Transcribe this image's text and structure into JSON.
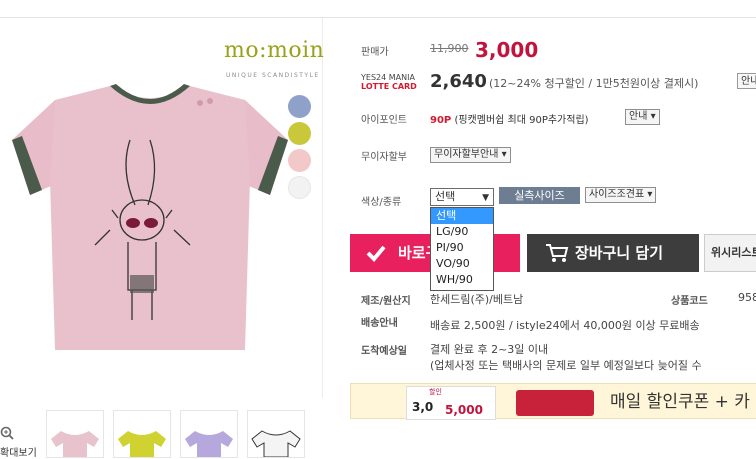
{
  "brand": {
    "logo": "mo:moin",
    "tagline": "UNIQUE SCANDISTYLE"
  },
  "product_image": {
    "print_text": "mo:moin"
  },
  "swatches": [
    "#8fa0c9",
    "#c8c83a",
    "#f2c8c8",
    "#f2f2f2"
  ],
  "thumbnails": {
    "zoom_label": "확대보기",
    "colors": [
      "#e8c2cc",
      "#cfd231",
      "#b6a7dc",
      "#f4f4f4"
    ]
  },
  "price": {
    "label": "판매가",
    "original": "11,900",
    "sale": "3,000"
  },
  "card": {
    "line1": "YES24 MANIA",
    "line2": "LOTTE CARD",
    "price": "2,640",
    "note": "(12~24% 청구할인 / 1만5천원이상 결제시)",
    "info_button": "안내"
  },
  "ipoint": {
    "label": "아이포인트",
    "value": "90P",
    "note": "(핑캣멤버쉽 최대 90P추가적립)",
    "info_button": "안내"
  },
  "installment": {
    "label": "무이자할부",
    "button": "무이자할부안내"
  },
  "option": {
    "label": "색상/종류",
    "selected": "선택",
    "options": [
      "선택",
      "LG/90",
      "PI/90",
      "VO/90",
      "WH/90"
    ],
    "size_button": "실측사이즈",
    "size_table_button": "사이즈조견표"
  },
  "actions": {
    "buy": "바로구매",
    "cart": "장바구니 담기",
    "wish": "위시리스트"
  },
  "details": {
    "maker_label": "제조/원산지",
    "maker_value": "한세드림(주)/베트남",
    "code_label": "상품코드",
    "code_value": "958",
    "shipping_label": "배송안내",
    "shipping_value": "배송료 2,500원 / istyle24에서 40,000원 이상 무료배송",
    "arrival_label": "도착예상일",
    "arrival_value": "결제 완료 후 2~3일 이내",
    "arrival_note": "(업체사정 또는 택배사의 문제로 일부 예정일보다 늦어질 수"
  },
  "banner": {
    "text": "매일 할인쿠폰 + 카",
    "coupon_value": "3,0",
    "coupon_value2": "5,000",
    "coupon_small": "할인"
  }
}
